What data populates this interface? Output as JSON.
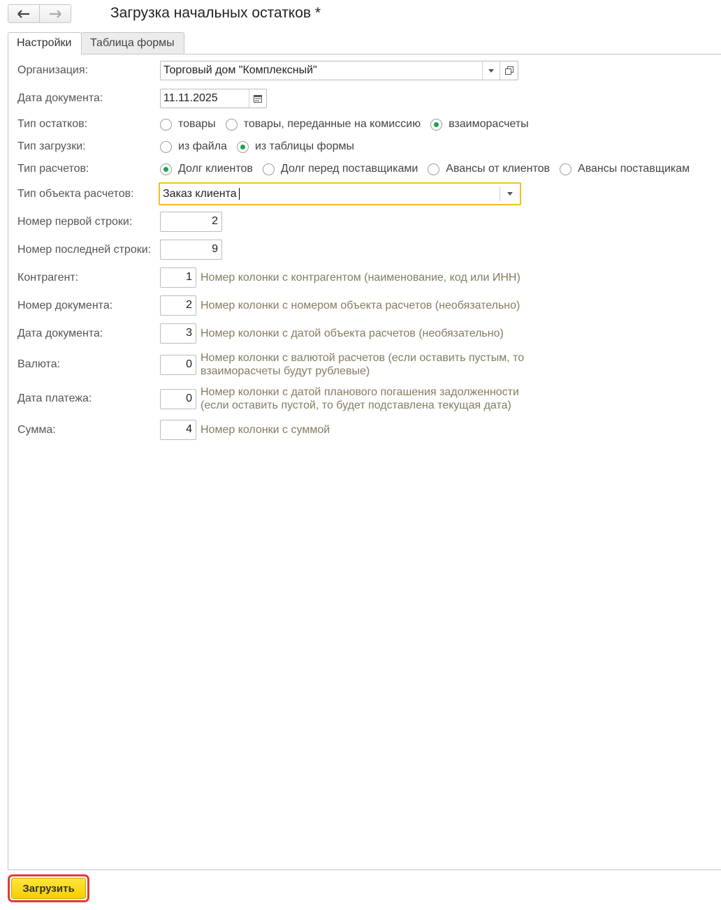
{
  "window": {
    "title": "Загрузка начальных остатков *"
  },
  "nav": {
    "back_icon": "arrow-left-icon",
    "forward_icon": "arrow-right-icon"
  },
  "tabs": [
    {
      "label": "Настройки",
      "active": true
    },
    {
      "label": "Таблица формы",
      "active": false
    }
  ],
  "form": {
    "organization": {
      "label": "Организация:",
      "value": "Торговый дом \"Комплексный\""
    },
    "doc_date": {
      "label": "Дата документа:",
      "value": "11.11.2025"
    },
    "balance_type": {
      "label": "Тип остатков:",
      "options": [
        "товары",
        "товары, переданные на комиссию",
        "взаиморасчеты"
      ],
      "selected": "взаиморасчеты"
    },
    "load_type": {
      "label": "Тип загрузки:",
      "options": [
        "из файла",
        "из таблицы формы"
      ],
      "selected": "из таблицы формы"
    },
    "settlement_type": {
      "label": "Тип расчетов:",
      "options": [
        "Долг клиентов",
        "Долг перед поставщиками",
        "Авансы от клиентов",
        "Авансы поставщикам"
      ],
      "selected": "Долг клиентов"
    },
    "settlement_object_type": {
      "label": "Тип объекта расчетов:",
      "value": "Заказ клиента"
    },
    "first_row": {
      "label": "Номер первой строки:",
      "value": "2"
    },
    "last_row": {
      "label": "Номер последней строки:",
      "value": "9"
    },
    "counterparty": {
      "label": "Контрагент:",
      "value": "1",
      "hint": "Номер колонки с контрагентом (наименование, код или ИНН)"
    },
    "doc_number": {
      "label": "Номер документа:",
      "value": "2",
      "hint": "Номер колонки с номером объекта расчетов (необязательно)"
    },
    "doc_date_col": {
      "label": "Дата документа:",
      "value": "3",
      "hint": "Номер колонки с датой объекта расчетов (необязательно)"
    },
    "currency": {
      "label": "Валюта:",
      "value": "0",
      "hint_line1": "Номер колонки с валютой расчетов (если оставить пустым, то",
      "hint_line2": "взаиморасчеты будут рублевые)"
    },
    "payment_date": {
      "label": "Дата платежа:",
      "value": "0",
      "hint_line1": "Номер колонки с датой планового погашения задолженности",
      "hint_line2": "(если оставить пустой, то будет подставлена текущая дата)"
    },
    "amount": {
      "label": "Сумма:",
      "value": "4",
      "hint": "Номер колонки с суммой"
    }
  },
  "footer": {
    "load_button": "Загрузить"
  },
  "colors": {
    "accent_yellow": "#f6cf00",
    "radio_selected": "#1aa34a",
    "focus_border": "#f0c020",
    "highlight_red": "#e53935",
    "hint_text": "#857b62"
  }
}
